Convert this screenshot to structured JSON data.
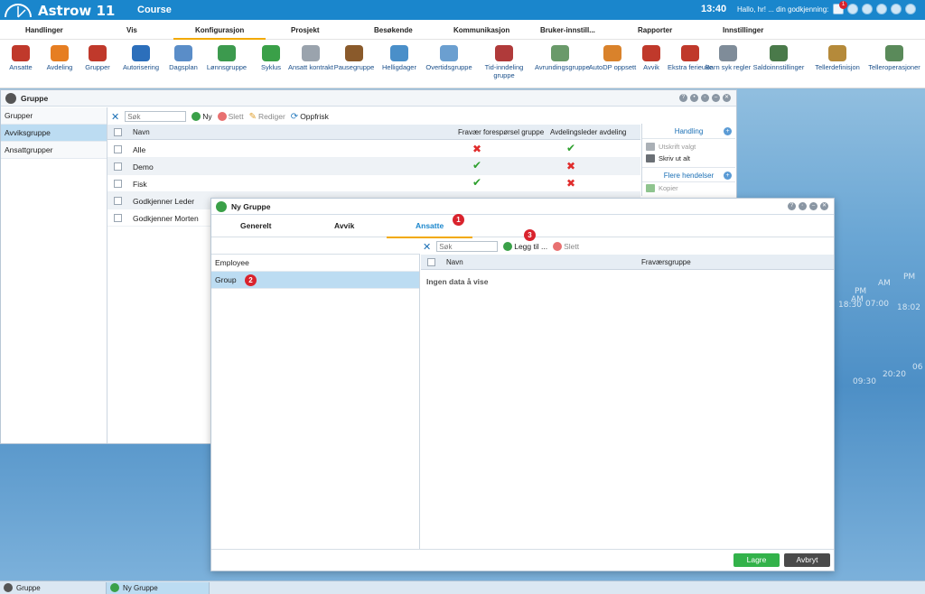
{
  "app": {
    "title": "Astrow 11",
    "course": "Course",
    "clock": "13:40",
    "greeting": "Hallo, hr! ... din godkjenning:",
    "notification_count": "1"
  },
  "menu": [
    "Handlinger",
    "Vis",
    "Konfigurasjon",
    "Prosjekt",
    "Besøkende",
    "Kommunikasjon",
    "Bruker-innstill...",
    "Rapporter",
    "Innstillinger"
  ],
  "toolbar": [
    {
      "label": "Ansatte",
      "icon": "user-icon",
      "color": "#c0392b"
    },
    {
      "label": "Avdeling",
      "icon": "department-icon",
      "color": "#e67e22"
    },
    {
      "label": "Grupper",
      "icon": "group-icon",
      "color": "#c0392b"
    },
    {
      "label": "Autorisering",
      "icon": "authorization-icon",
      "color": "#2c6fbb"
    },
    {
      "label": "Dagsplan",
      "icon": "dayplan-icon",
      "color": "#5a8dc8"
    },
    {
      "label": "Lønnsgruppe",
      "icon": "salary-group-icon",
      "color": "#3c9a4e"
    },
    {
      "label": "Syklus",
      "icon": "cycle-icon",
      "color": "#3aa048"
    },
    {
      "label": "Ansatt kontrakt",
      "icon": "contract-icon",
      "color": "#9aa3ad"
    },
    {
      "label": "Pausegruppe",
      "icon": "pause-icon",
      "color": "#8a5a2b"
    },
    {
      "label": "Helligdager",
      "icon": "holiday-icon",
      "color": "#4a8fc9"
    },
    {
      "label": "Overtidsgruppe",
      "icon": "overtime-icon",
      "color": "#6b9fd0"
    },
    {
      "label": "Tid-inndeling gruppe",
      "icon": "scissors-icon",
      "color": "#b03a3a"
    },
    {
      "label": "Avrundingsgruppe",
      "icon": "rounding-icon",
      "color": "#6a9a6a"
    },
    {
      "label": "AutoDP oppsett",
      "icon": "autodp-icon",
      "color": "#d9822b"
    },
    {
      "label": "Avvik",
      "icon": "deviation-icon",
      "color": "#c0392b"
    },
    {
      "label": "Ekstra ferieuke",
      "icon": "vacation-icon",
      "color": "#c0392b"
    },
    {
      "label": "Barn syk regler",
      "icon": "child-sick-icon",
      "color": "#7f8c99"
    },
    {
      "label": "Saldoinnstillinger",
      "icon": "balance-settings-icon",
      "color": "#4a7a4a"
    },
    {
      "label": "Tellerdefinisjon",
      "icon": "counter-definition-icon",
      "color": "#b58a3a"
    },
    {
      "label": "Telleroperasjoner",
      "icon": "counter-operations-icon",
      "color": "#5a8a5a"
    }
  ],
  "gruppe_panel": {
    "title": "Gruppe",
    "sidebar": [
      "Grupper",
      "Avviksgruppe",
      "Ansattgrupper"
    ],
    "search_placeholder": "Søk",
    "actions": {
      "new": "Ny",
      "delete": "Slett",
      "edit": "Rediger",
      "refresh": "Oppfrisk"
    },
    "columns": {
      "name": "Navn",
      "col2": "Fravær forespørsel gruppe",
      "col3": "Avdelingsleder avdeling"
    },
    "rows": [
      {
        "name": "Alle",
        "col2": "no",
        "col3": "yes"
      },
      {
        "name": "Demo",
        "col2": "yes",
        "col3": "no"
      },
      {
        "name": "Fisk",
        "col2": "yes",
        "col3": "no"
      },
      {
        "name": "Godkjenner Leder",
        "col2": "yes",
        "col3": "no"
      },
      {
        "name": "Godkjenner Morten",
        "col2": "",
        "col3": ""
      }
    ],
    "handling": {
      "title": "Handling",
      "print_selected": "Utskrift valgt",
      "print_all": "Skriv ut alt",
      "more_events": "Flere hendelser",
      "copy": "Kopier"
    }
  },
  "dialog": {
    "title": "Ny Gruppe",
    "tabs": [
      "Generelt",
      "Avvik",
      "Ansatte"
    ],
    "badges": [
      "1",
      "2",
      "3"
    ],
    "left_list": [
      "Employee",
      "Group"
    ],
    "search_placeholder": "Søk",
    "add_label": "Legg til ...",
    "delete_label": "Slett",
    "columns": {
      "name": "Navn",
      "group": "Fraværsgruppe"
    },
    "empty": "Ingen data å vise",
    "save": "Lagre",
    "cancel": "Avbryt"
  },
  "taskbar": [
    "Gruppe",
    "Ny Gruppe"
  ],
  "background_clock": [
    "AM",
    "PM",
    "AM",
    "PM",
    "18:30",
    "07:00",
    "18:02",
    "09:30",
    "20:20",
    "06"
  ],
  "colors": {
    "accent": "#1a86cc",
    "tab_underline": "#f2a900",
    "save": "#33b24a",
    "cancel": "#4a4a4a",
    "badge": "#d9232d"
  }
}
